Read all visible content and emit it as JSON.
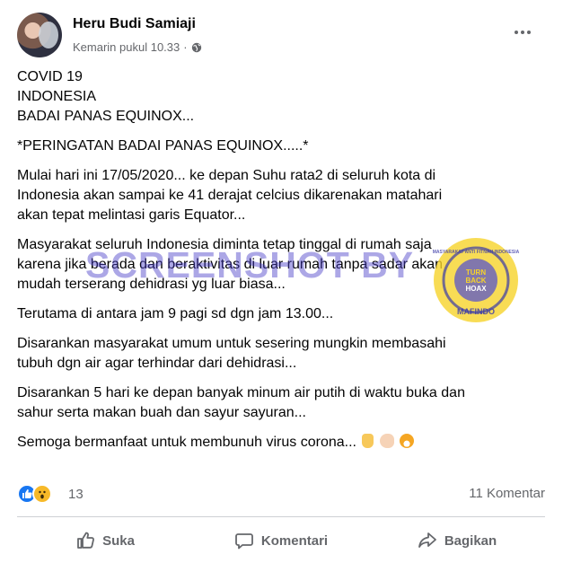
{
  "post": {
    "author": "Heru Budi Samiaji",
    "timestamp": "Kemarin pukul 10.33",
    "privacy_icon": "globe-icon",
    "more_icon": "more-options-icon",
    "paragraphs": [
      {
        "lines": [
          "COVID 19",
          "INDONESIA",
          "BADAI PANAS EQUINOX..."
        ]
      },
      {
        "lines": [
          "*PERINGATAN BADAI PANAS EQUINOX.....*"
        ]
      },
      {
        "lines": [
          "Mulai hari ini 17/05/2020... ke depan Suhu rata2 di seluruh kota di",
          "Indonesia akan sampai ke 41 derajat celcius  dikarenakan matahari",
          "akan tepat melintasi garis Equator..."
        ]
      },
      {
        "lines": [
          "Masyarakat seluruh Indonesia diminta tetap tinggal di rumah saja",
          "karena jika berada dan beraktivitas di luar rumah tanpa sadar akan",
          "mudah terserang dehidrasi yg luar biasa..."
        ]
      },
      {
        "lines": [
          "Terutama di antara jam 9 pagi sd dgn jam 13.00..."
        ]
      },
      {
        "lines": [
          "Disarankan masyarakat umum untuk sesering mungkin membasahi",
          "tubuh dgn air agar terhindar dari dehidrasi..."
        ]
      },
      {
        "lines": [
          "Disarankan 5 hari ke depan banyak minum air putih di waktu buka dan",
          "sahur serta makan buah dan sayur sayuran..."
        ]
      },
      {
        "lines": [
          "Semoga bermanfaat untuk membunuh virus corona..."
        ]
      }
    ],
    "closing_emojis": [
      "thumbs-up-emoji",
      "flexed-biceps-emoji",
      "grinning-face-emoji"
    ]
  },
  "watermark": {
    "text": "SCREENSHOT BY",
    "seal_top": "MASYARAKAT ANTI FITNAH INDONESIA",
    "seal_center_1": "TURN",
    "seal_center_2": "BACK",
    "seal_center_3": "HOAX",
    "seal_bottom": "MAFINDO"
  },
  "stats": {
    "reactions": [
      "like-reaction-icon",
      "wow-reaction-icon"
    ],
    "reaction_count": "13",
    "comments_count": "11 Komentar"
  },
  "actions": {
    "like": "Suka",
    "comment": "Komentari",
    "share": "Bagikan"
  },
  "colors": {
    "primary_text": "#050505",
    "secondary_text": "#65676b",
    "like_blue": "#1877f2",
    "wow_yellow": "#f7b928",
    "divider": "#ced0d4",
    "watermark": "#463cc8"
  }
}
